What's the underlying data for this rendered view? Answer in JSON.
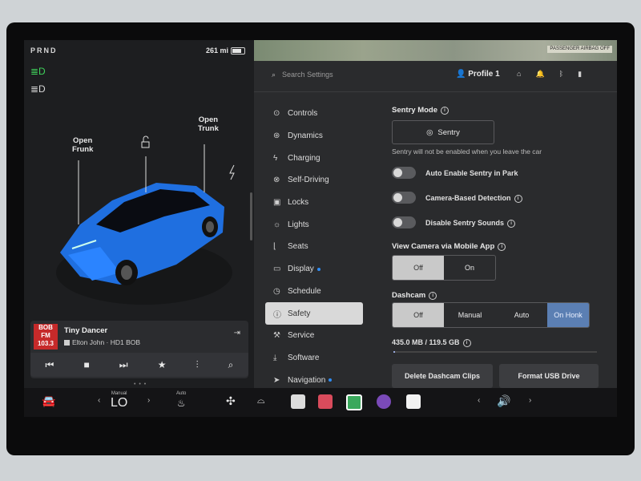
{
  "status": {
    "gear": "PRND",
    "range": "261 mi"
  },
  "car": {
    "frunk_label": "Open\nFrunk",
    "trunk_label": "Open\nTrunk",
    "car_color": "#1f6fe0"
  },
  "media": {
    "station_logo": "BOB FM 103.3",
    "song": "Tiny Dancer",
    "artist": "Elton John · HD1 BOB",
    "controls": [
      "prev-icon",
      "stop-icon",
      "next-icon",
      "favorite-icon",
      "equalizer-icon",
      "search-icon"
    ]
  },
  "map": {
    "passenger_airbag": "PASSENGER AIRBAG OFF"
  },
  "topbar": {
    "search_placeholder": "Search Settings",
    "profile": "Profile 1"
  },
  "nav": [
    {
      "label": "Controls",
      "icon": "toggle-icon"
    },
    {
      "label": "Dynamics",
      "icon": "car-icon"
    },
    {
      "label": "Charging",
      "icon": "bolt-icon"
    },
    {
      "label": "Self-Driving",
      "icon": "steering-icon"
    },
    {
      "label": "Locks",
      "icon": "lock-icon"
    },
    {
      "label": "Lights",
      "icon": "sun-icon"
    },
    {
      "label": "Seats",
      "icon": "seat-icon"
    },
    {
      "label": "Display",
      "icon": "display-icon"
    },
    {
      "label": "Schedule",
      "icon": "clock-icon"
    },
    {
      "label": "Safety",
      "icon": "safety-icon"
    },
    {
      "label": "Service",
      "icon": "wrench-icon"
    },
    {
      "label": "Software",
      "icon": "download-icon"
    },
    {
      "label": "Navigation",
      "icon": "navigation-icon"
    }
  ],
  "safety": {
    "sentry_title": "Sentry Mode",
    "sentry_button": "Sentry",
    "sentry_note": "Sentry will not be enabled when you leave the car",
    "toggle1": "Auto Enable Sentry in Park",
    "toggle2": "Camera-Based Detection",
    "toggle3": "Disable Sentry Sounds",
    "view_camera_title": "View Camera via Mobile App",
    "view_off": "Off",
    "view_on": "On",
    "dashcam_title": "Dashcam",
    "dash_off": "Off",
    "dash_manual": "Manual",
    "dash_auto": "Auto",
    "dash_honk": "On Honk",
    "storage": "435.0 MB / 119.5 GB",
    "storage_fraction": 0.0036,
    "delete_btn": "Delete Dashcam Clips",
    "format_btn": "Format USB Drive"
  },
  "dock": {
    "temp_label": "Manual",
    "temp_value": "LO",
    "seat_heat_label": "Auto"
  }
}
